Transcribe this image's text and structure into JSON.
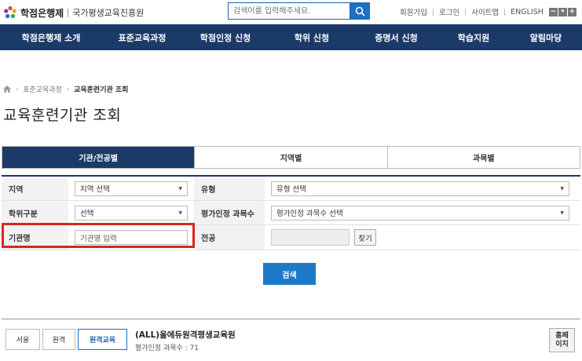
{
  "header": {
    "logo_name": "학점은행제",
    "logo_org": "국가평생교육진흥원",
    "search_placeholder": "검색어를 입력해주세요.",
    "util_links": [
      "회원가입",
      "로그인",
      "사이트맵",
      "ENGLISH"
    ],
    "zoom": [
      "−",
      "•",
      "+"
    ]
  },
  "nav": {
    "items": [
      "학점은행제 소개",
      "표준교육과정",
      "학점인정 신청",
      "학위 신청",
      "증명서 신청",
      "학습지원",
      "알림마당"
    ]
  },
  "breadcrumb": {
    "items": [
      "표준교육과정",
      "교육훈련기관 조회"
    ]
  },
  "page_title": "교육훈련기관 조회",
  "tabs": [
    {
      "label": "기관/전공별",
      "active": true
    },
    {
      "label": "지역별",
      "active": false
    },
    {
      "label": "과목별",
      "active": false
    }
  ],
  "form": {
    "region_label": "지역",
    "region_value": "지역 선택",
    "type_label": "유형",
    "type_value": "유형 선택",
    "degree_label": "학위구분",
    "degree_value": "선택",
    "credit_label": "평가인정 과목수",
    "credit_value": "평가인정 과목수 선택",
    "inst_label": "기관명",
    "inst_placeholder": "기관명 입력",
    "major_label": "전공",
    "find_label": "찾기",
    "search_label": "검색"
  },
  "result": {
    "tags": [
      "서울",
      "원격",
      "원격교육"
    ],
    "title": "(ALL)올에듀원격평생교육원",
    "subtitle": "평가인정 과목수 : 71",
    "home_line1": "홈페",
    "home_line2": "이지"
  },
  "colors": {
    "nav_bg": "#1b3a67",
    "accent_blue": "#1e7ac8",
    "highlight_red": "#d9261c"
  }
}
